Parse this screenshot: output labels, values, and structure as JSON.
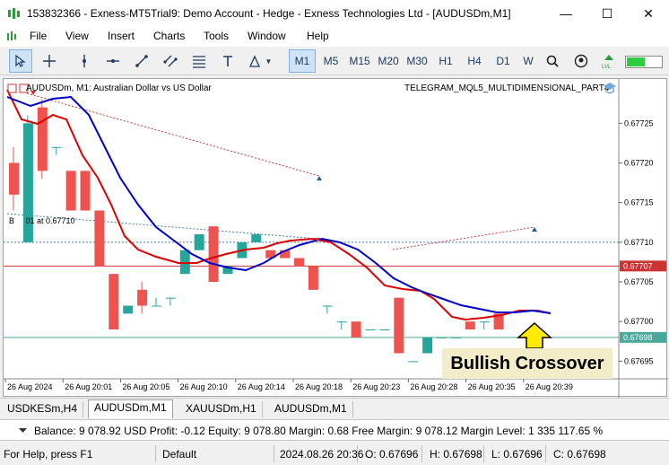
{
  "window": {
    "title": "153832366 - Exness-MT5Trial9: Demo Account - Hedge - Exness Technologies Ltd - [AUDUSDm,M1]",
    "min_icon": "minimize-icon",
    "max_icon": "maximize-icon",
    "close_icon": "close-icon"
  },
  "menu": [
    "File",
    "View",
    "Insert",
    "Charts",
    "Tools",
    "Window",
    "Help"
  ],
  "toolbar": {
    "timeframes": [
      "M1",
      "M5",
      "M15",
      "M20",
      "M30",
      "H1",
      "H4",
      "D1",
      "W"
    ],
    "selected_timeframe": "M1"
  },
  "chart": {
    "symbol_title": "AUDUSDm, M1:  Australian Dollar vs US Dollar",
    "ea_title": "TELEGRAM_MQL5_MULTIDIMENSIONAL_PART4",
    "label_buy": "B     01 at 0.67710",
    "annotation": "Bullish Crossover",
    "price_ticks": [
      "0.67725",
      "0.67720",
      "0.67715",
      "0.67710",
      "0.67705",
      "0.67700",
      "0.67695"
    ],
    "price_tag_red": "0.67707",
    "price_tag_green": "0.67698",
    "time_ticks": [
      "26 Aug 2024",
      "26 Aug 20:01",
      "26 Aug 20:05",
      "26 Aug 20:10",
      "26 Aug 20:14",
      "26 Aug 20:18",
      "26 Aug 20:23",
      "26 Aug 20:28",
      "26 Aug 20:35",
      "26 Aug 20:39"
    ],
    "colors": {
      "bull": "#26a69a",
      "bear": "#ef5350",
      "fast_ma": "#dd0000",
      "slow_ma": "#0000cc",
      "bid_line": "#4aa89a",
      "ask_line": "#cc3333"
    }
  },
  "chart_data": {
    "type": "candlestick",
    "ylim": [
      0.67693,
      0.67729
    ],
    "candles": [
      {
        "o": 0.6772,
        "c": 0.67716,
        "h": 0.67722,
        "l": 0.67714
      },
      {
        "o": 0.6771,
        "c": 0.67725,
        "h": 0.67726,
        "l": 0.6771
      },
      {
        "o": 0.67727,
        "c": 0.67719,
        "h": 0.67728,
        "l": 0.67718
      },
      {
        "o": 0.67722,
        "c": 0.67722,
        "h": 0.67722,
        "l": 0.67721
      },
      {
        "o": 0.67719,
        "c": 0.67714,
        "h": 0.67719,
        "l": 0.67714
      },
      {
        "o": 0.67719,
        "c": 0.67714,
        "h": 0.67719,
        "l": 0.67714
      },
      {
        "o": 0.67714,
        "c": 0.67707,
        "h": 0.67714,
        "l": 0.67707
      },
      {
        "o": 0.67706,
        "c": 0.67699,
        "h": 0.67706,
        "l": 0.67699
      },
      {
        "o": 0.67701,
        "c": 0.67702,
        "h": 0.67702,
        "l": 0.67701
      },
      {
        "o": 0.67704,
        "c": 0.67702,
        "h": 0.67705,
        "l": 0.67701
      },
      {
        "o": 0.67702,
        "c": 0.67702,
        "h": 0.67703,
        "l": 0.67702
      },
      {
        "o": 0.67703,
        "c": 0.67703,
        "h": 0.67703,
        "l": 0.67702
      },
      {
        "o": 0.67706,
        "c": 0.67709,
        "h": 0.67709,
        "l": 0.67706
      },
      {
        "o": 0.67709,
        "c": 0.67711,
        "h": 0.67711,
        "l": 0.67709
      },
      {
        "o": 0.67712,
        "c": 0.67705,
        "h": 0.67712,
        "l": 0.67705
      },
      {
        "o": 0.67706,
        "c": 0.67707,
        "h": 0.67707,
        "l": 0.67706
      },
      {
        "o": 0.67708,
        "c": 0.6771,
        "h": 0.6771,
        "l": 0.67708
      },
      {
        "o": 0.6771,
        "c": 0.67711,
        "h": 0.67711,
        "l": 0.6771
      },
      {
        "o": 0.67709,
        "c": 0.67708,
        "h": 0.67709,
        "l": 0.67708
      },
      {
        "o": 0.67709,
        "c": 0.67708,
        "h": 0.67709,
        "l": 0.67708
      },
      {
        "o": 0.67708,
        "c": 0.67707,
        "h": 0.67708,
        "l": 0.67707
      },
      {
        "o": 0.67707,
        "c": 0.67704,
        "h": 0.67707,
        "l": 0.67704
      },
      {
        "o": 0.67702,
        "c": 0.67702,
        "h": 0.67702,
        "l": 0.67701
      },
      {
        "o": 0.677,
        "c": 0.677,
        "h": 0.677,
        "l": 0.67699
      },
      {
        "o": 0.677,
        "c": 0.67698,
        "h": 0.677,
        "l": 0.67698
      },
      {
        "o": 0.67699,
        "c": 0.67699,
        "h": 0.67699,
        "l": 0.67699
      },
      {
        "o": 0.67699,
        "c": 0.67699,
        "h": 0.67699,
        "l": 0.67699
      },
      {
        "o": 0.67703,
        "c": 0.67696,
        "h": 0.67703,
        "l": 0.67696
      },
      {
        "o": 0.67695,
        "c": 0.67695,
        "h": 0.67695,
        "l": 0.67695
      },
      {
        "o": 0.67696,
        "c": 0.67698,
        "h": 0.67698,
        "l": 0.67696
      },
      {
        "o": 0.67698,
        "c": 0.67698,
        "h": 0.67698,
        "l": 0.67698
      },
      {
        "o": 0.67698,
        "c": 0.67698,
        "h": 0.67698,
        "l": 0.67698
      },
      {
        "o": 0.677,
        "c": 0.67699,
        "h": 0.677,
        "l": 0.67699
      },
      {
        "o": 0.677,
        "c": 0.677,
        "h": 0.677,
        "l": 0.67699
      },
      {
        "o": 0.67701,
        "c": 0.67699,
        "h": 0.67701,
        "l": 0.67699
      }
    ]
  },
  "tabs": [
    "USDKESm,H4",
    "AUDUSDm,M1",
    "XAUUSDm,H1",
    "AUDUSDm,M1"
  ],
  "active_tab": 1,
  "balance": "Balance: 9 078.92 USD  Profit: -0.12  Equity: 9 078.80  Margin: 0.68  Free Margin: 9 078.12  Margin Level: 1 335 117.65 %",
  "status": {
    "help": "For Help, press F1",
    "profile": "Default",
    "datetime": "2024.08.26 20:36",
    "open": "O: 0.67696",
    "high": "H: 0.67698",
    "low": "L: 0.67696",
    "close": "C: 0.67698"
  }
}
